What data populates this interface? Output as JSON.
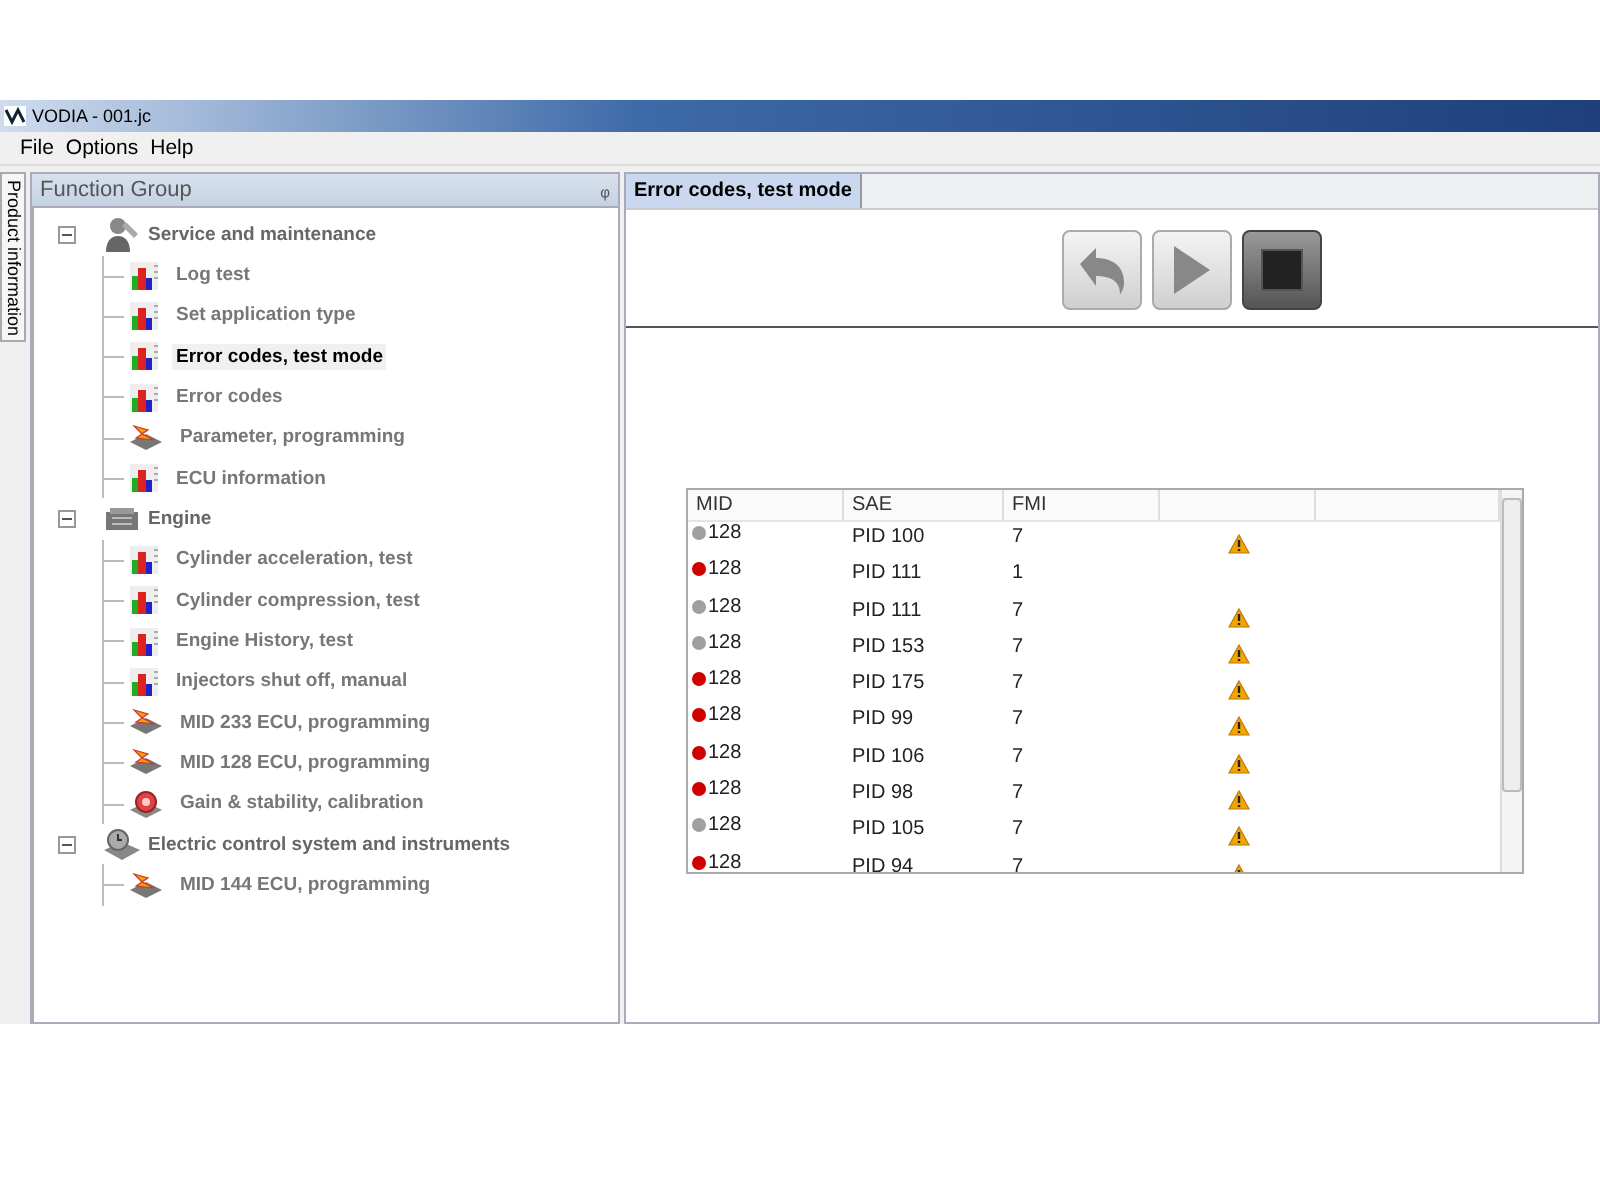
{
  "window": {
    "title": "VODIA - 001.jc"
  },
  "menu": [
    "File",
    "Options",
    "Help"
  ],
  "side_tab": {
    "label": "Product information"
  },
  "function_group": {
    "title": "Function Group",
    "pin": "ᵩ",
    "tree": [
      {
        "label": "Service and maintenance",
        "kind": "service",
        "expanded": true,
        "children": [
          {
            "label": "Log test",
            "kind": "chart",
            "selected": false
          },
          {
            "label": "Set application type",
            "kind": "chart",
            "selected": false
          },
          {
            "label": "Error codes, test mode",
            "kind": "chart",
            "selected": true
          },
          {
            "label": "Error codes",
            "kind": "chart",
            "selected": false
          },
          {
            "label": "Parameter, programming",
            "kind": "programming",
            "selected": false
          },
          {
            "label": "ECU information",
            "kind": "chart",
            "selected": false
          }
        ]
      },
      {
        "label": "Engine",
        "kind": "engine",
        "expanded": true,
        "children": [
          {
            "label": "Cylinder acceleration, test",
            "kind": "chart",
            "selected": false
          },
          {
            "label": "Cylinder compression, test",
            "kind": "chart",
            "selected": false
          },
          {
            "label": "Engine History, test",
            "kind": "chart",
            "selected": false
          },
          {
            "label": "Injectors shut off, manual",
            "kind": "chart",
            "selected": false
          },
          {
            "label": "MID 233 ECU, programming",
            "kind": "programming",
            "selected": false
          },
          {
            "label": "MID 128 ECU, programming",
            "kind": "programming",
            "selected": false
          },
          {
            "label": "Gain & stability, calibration",
            "kind": "gain",
            "selected": false
          }
        ]
      },
      {
        "label": "Electric control system and instruments",
        "kind": "electric",
        "expanded": true,
        "children": [
          {
            "label": "MID 144 ECU, programming",
            "kind": "programming",
            "selected": false
          }
        ]
      }
    ]
  },
  "tabs": [
    {
      "label": "Error codes, test mode",
      "selected": true
    }
  ],
  "toolbar": [
    {
      "kind": "back",
      "disabled": true
    },
    {
      "kind": "play",
      "disabled": true
    },
    {
      "kind": "stop",
      "disabled": false
    }
  ],
  "table": {
    "columns": [
      "MID",
      "SAE",
      "FMI"
    ],
    "rows": [
      {
        "mid": "128",
        "sae": "PID 100",
        "fmi": "7",
        "color": "#a0a0a0",
        "warning": true
      },
      {
        "mid": "128",
        "sae": "PID 111",
        "fmi": "1",
        "color": "#d00000",
        "warning": false
      },
      {
        "mid": "128",
        "sae": "PID 111",
        "fmi": "7",
        "color": "#a0a0a0",
        "warning": true
      },
      {
        "mid": "128",
        "sae": "PID 153",
        "fmi": "7",
        "color": "#a0a0a0",
        "warning": true
      },
      {
        "mid": "128",
        "sae": "PID 175",
        "fmi": "7",
        "color": "#d00000",
        "warning": true
      },
      {
        "mid": "128",
        "sae": "PID 99",
        "fmi": "7",
        "color": "#d00000",
        "warning": true
      },
      {
        "mid": "128",
        "sae": "PID 106",
        "fmi": "7",
        "color": "#d00000",
        "warning": true
      },
      {
        "mid": "128",
        "sae": "PID 98",
        "fmi": "7",
        "color": "#d00000",
        "warning": true
      },
      {
        "mid": "128",
        "sae": "PID 105",
        "fmi": "7",
        "color": "#a0a0a0",
        "warning": true
      },
      {
        "mid": "128",
        "sae": "PID 94",
        "fmi": "7",
        "color": "#d00000",
        "warning": true
      }
    ]
  }
}
